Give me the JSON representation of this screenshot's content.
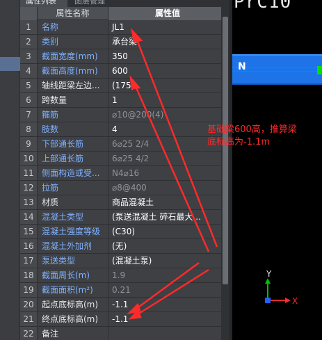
{
  "tabs": [
    "属性列表",
    "图层管理"
  ],
  "table": {
    "header_name": "属性名称",
    "header_value": "属性值",
    "rows": [
      {
        "idx": "1",
        "name": "名称",
        "value": "JL1",
        "name_style": "blue",
        "value_style": "white"
      },
      {
        "idx": "2",
        "name": "类别",
        "value": "承台梁",
        "name_style": "blue",
        "value_style": "white"
      },
      {
        "idx": "3",
        "name": "截面宽度(mm)",
        "value": "350",
        "name_style": "blue",
        "value_style": "white"
      },
      {
        "idx": "4",
        "name": "截面高度(mm)",
        "value": "600",
        "name_style": "blue",
        "value_style": "white"
      },
      {
        "idx": "5",
        "name": "轴线距梁左边...",
        "value": "(175)",
        "name_style": "white",
        "value_style": "white"
      },
      {
        "idx": "6",
        "name": "跨数量",
        "value": "1",
        "name_style": "white",
        "value_style": "white"
      },
      {
        "idx": "7",
        "name": "箍筋",
        "value": "⌀10@200(4)",
        "name_style": "blue",
        "value_style": "gray"
      },
      {
        "idx": "8",
        "name": "肢数",
        "value": "4",
        "name_style": "blue",
        "value_style": "white"
      },
      {
        "idx": "9",
        "name": "下部通长筋",
        "value": "6⌀25 2/4",
        "name_style": "blue",
        "value_style": "gray"
      },
      {
        "idx": "10",
        "name": "上部通长筋",
        "value": "6⌀25 4/2",
        "name_style": "blue",
        "value_style": "gray"
      },
      {
        "idx": "11",
        "name": "侧面构造或受...",
        "value": "N4⌀16",
        "name_style": "blue",
        "value_style": "gray"
      },
      {
        "idx": "12",
        "name": "拉筋",
        "value": "⌀8@400",
        "name_style": "blue",
        "value_style": "gray"
      },
      {
        "idx": "13",
        "name": "材质",
        "value": "商品混凝土",
        "name_style": "white",
        "value_style": "white"
      },
      {
        "idx": "14",
        "name": "混凝土类型",
        "value": "(泵送混凝土 碎石最大...",
        "name_style": "blue",
        "value_style": "white"
      },
      {
        "idx": "15",
        "name": "混凝土强度等级",
        "value": "(C30)",
        "name_style": "blue",
        "value_style": "white"
      },
      {
        "idx": "16",
        "name": "混凝土外加剂",
        "value": "(无)",
        "name_style": "blue",
        "value_style": "white"
      },
      {
        "idx": "17",
        "name": "泵送类型",
        "value": "(混凝土泵)",
        "name_style": "blue",
        "value_style": "white"
      },
      {
        "idx": "18",
        "name": "截面周长(m)",
        "value": "1.9",
        "name_style": "blue",
        "value_style": "gray"
      },
      {
        "idx": "19",
        "name": "截面面积(m²)",
        "value": "0.21",
        "name_style": "blue",
        "value_style": "gray"
      },
      {
        "idx": "20",
        "name": "起点底标高(m)",
        "value": "-1.1",
        "name_style": "white",
        "value_style": "white"
      },
      {
        "idx": "21",
        "name": "终点底标高(m)",
        "value": "-1.1",
        "name_style": "white",
        "value_style": "white"
      },
      {
        "idx": "22",
        "name": "备注",
        "value": "",
        "name_style": "white",
        "value_style": "white"
      }
    ]
  },
  "canvas": {
    "title": "PrC10",
    "beam_label": "N",
    "axis_x": "X",
    "axis_y": "Y"
  },
  "annotation": {
    "line1": "基础梁600高，推算梁",
    "line2": "底标高为-1.1m"
  },
  "colors": {
    "annotation": "#ff2a2a",
    "beam": "#1e73e6",
    "blue_label": "#7fb0ff",
    "axis_x": "#ff2a2a",
    "axis_y": "#00c000",
    "axis_z": "#2060ff"
  }
}
